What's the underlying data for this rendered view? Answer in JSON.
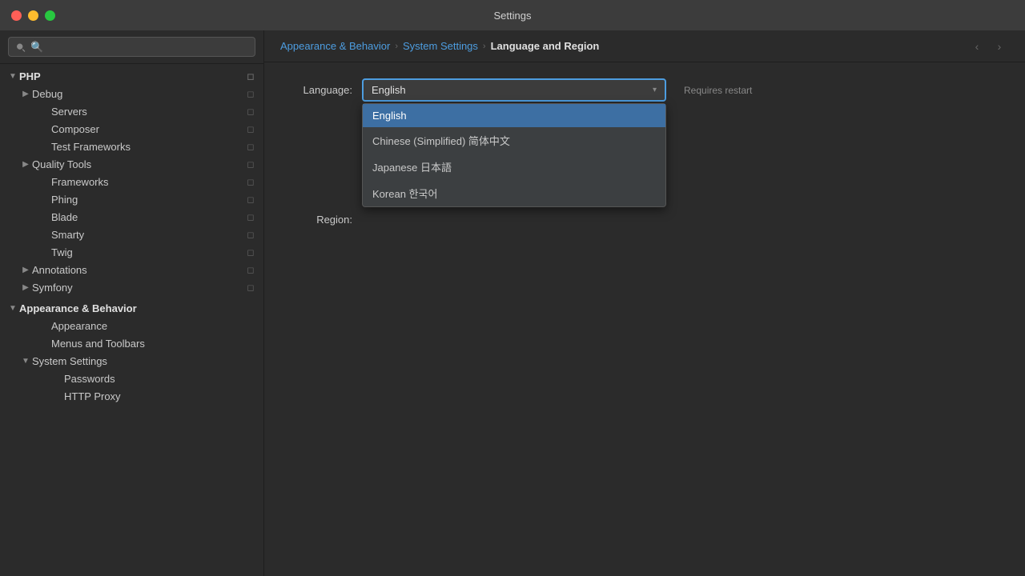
{
  "titlebar": {
    "title": "Settings"
  },
  "sidebar": {
    "search_placeholder": "🔍",
    "items": [
      {
        "id": "php",
        "label": "PHP",
        "level": 0,
        "type": "section",
        "expanded": true,
        "has_pin": true
      },
      {
        "id": "debug",
        "label": "Debug",
        "level": 1,
        "type": "expandable",
        "expanded": false,
        "has_pin": true
      },
      {
        "id": "servers",
        "label": "Servers",
        "level": 2,
        "type": "leaf",
        "has_pin": true
      },
      {
        "id": "composer",
        "label": "Composer",
        "level": 2,
        "type": "leaf",
        "has_pin": true
      },
      {
        "id": "test-frameworks",
        "label": "Test Frameworks",
        "level": 2,
        "type": "leaf",
        "has_pin": true
      },
      {
        "id": "quality-tools",
        "label": "Quality Tools",
        "level": 1,
        "type": "expandable",
        "expanded": false,
        "has_pin": true
      },
      {
        "id": "frameworks",
        "label": "Frameworks",
        "level": 2,
        "type": "leaf",
        "has_pin": true
      },
      {
        "id": "phing",
        "label": "Phing",
        "level": 2,
        "type": "leaf",
        "has_pin": true
      },
      {
        "id": "blade",
        "label": "Blade",
        "level": 2,
        "type": "leaf",
        "has_pin": true
      },
      {
        "id": "smarty",
        "label": "Smarty",
        "level": 2,
        "type": "leaf",
        "has_pin": true
      },
      {
        "id": "twig",
        "label": "Twig",
        "level": 2,
        "type": "leaf",
        "has_pin": true
      },
      {
        "id": "annotations",
        "label": "Annotations",
        "level": 1,
        "type": "expandable",
        "expanded": false,
        "has_pin": true
      },
      {
        "id": "symfony",
        "label": "Symfony",
        "level": 1,
        "type": "expandable",
        "expanded": false,
        "has_pin": true
      },
      {
        "id": "appearance-behavior",
        "label": "Appearance & Behavior",
        "level": 0,
        "type": "section",
        "expanded": true,
        "has_pin": false
      },
      {
        "id": "appearance",
        "label": "Appearance",
        "level": 2,
        "type": "leaf",
        "has_pin": false
      },
      {
        "id": "menus-toolbars",
        "label": "Menus and Toolbars",
        "level": 2,
        "type": "leaf",
        "has_pin": false
      },
      {
        "id": "system-settings",
        "label": "System Settings",
        "level": 1,
        "type": "expandable",
        "expanded": true,
        "has_pin": false
      },
      {
        "id": "passwords",
        "label": "Passwords",
        "level": 3,
        "type": "leaf",
        "has_pin": false
      },
      {
        "id": "http-proxy",
        "label": "HTTP Proxy",
        "level": 3,
        "type": "leaf",
        "has_pin": false
      }
    ]
  },
  "breadcrumb": {
    "items": [
      {
        "id": "appearance-behavior",
        "label": "Appearance & Behavior",
        "is_link": true
      },
      {
        "id": "system-settings",
        "label": "System Settings",
        "is_link": true
      },
      {
        "id": "language-region",
        "label": "Language and Region",
        "is_link": false
      }
    ]
  },
  "content": {
    "language_label": "Language:",
    "region_label": "Region:",
    "requires_restart": "Requires restart",
    "selected_language": "English",
    "language_options": [
      {
        "id": "english",
        "label": "English",
        "selected": true
      },
      {
        "id": "chinese-simplified",
        "label": "Chinese (Simplified) 简体中文",
        "selected": false
      },
      {
        "id": "japanese",
        "label": "Japanese 日本語",
        "selected": false
      },
      {
        "id": "korean",
        "label": "Korean 한국어",
        "selected": false
      }
    ]
  },
  "icons": {
    "chevron_right": "›",
    "chevron_down": "▾",
    "chevron_right_small": "›",
    "back_arrow": "‹",
    "forward_arrow": "›",
    "pin": "📌",
    "search": "🔍"
  }
}
